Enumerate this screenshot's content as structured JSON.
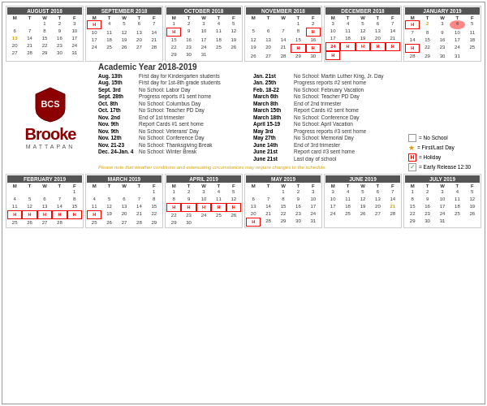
{
  "title": "Academic Year 2018-2019",
  "logo": {
    "initials": "BCS",
    "name": "Brooke",
    "location": "MATTAPAN"
  },
  "legend": {
    "noschool": "= No School",
    "firstlast": "= First/Last Day",
    "holiday": "= Holiday",
    "earlyrelease": "= Early Release 12:30"
  },
  "notice": "Please note that weather conditions and extenuating circumstances may require changes to the schedule.",
  "months_top": [
    {
      "name": "AUGUST 2018",
      "headers": [
        "M",
        "T",
        "W",
        "T",
        "F"
      ],
      "weeks": [
        [
          "",
          "",
          "1",
          "2",
          "3"
        ],
        [
          "6",
          "7",
          "8",
          "9",
          "10"
        ],
        [
          "13",
          "14",
          "15",
          "16",
          "17"
        ],
        [
          "20",
          "21",
          "22",
          "23",
          "24"
        ],
        [
          "27",
          "28",
          "29",
          "30",
          "31"
        ]
      ],
      "special": {
        "13": "firstlast",
        "15": "earlyrel"
      }
    },
    {
      "name": "SEPTEMBER 2018",
      "headers": [
        "M",
        "T",
        "W",
        "T",
        "F"
      ],
      "weeks": [
        [
          "H",
          "4",
          "5",
          "6",
          "7"
        ],
        [
          "10",
          "11",
          "12",
          "13",
          "14"
        ],
        [
          "17",
          "18",
          "19",
          "20",
          "21"
        ],
        [
          "24",
          "25",
          "26",
          "27",
          "28"
        ],
        [
          "",
          "",
          "",
          "",
          ""
        ]
      ],
      "special": {
        "H": "holiday",
        "3": "noschool"
      }
    },
    {
      "name": "OCTOBER 2018",
      "headers": [
        "M",
        "T",
        "W",
        "T",
        "F"
      ],
      "weeks": [
        [
          "1",
          "2",
          "3",
          "4",
          "5"
        ],
        [
          "H",
          "9",
          "10",
          "11",
          "12"
        ],
        [
          "15",
          "16",
          "17",
          "18",
          "19"
        ],
        [
          "22",
          "23",
          "24",
          "25",
          "26"
        ],
        [
          "29",
          "30",
          "31",
          "",
          ""
        ]
      ],
      "special": {
        "8": "holiday",
        "17": "earlyrel"
      }
    },
    {
      "name": "NOVEMBER 2018",
      "headers": [
        "M",
        "T",
        "W",
        "T",
        "F"
      ],
      "weeks": [
        [
          "",
          "",
          "",
          "1",
          "2"
        ],
        [
          "5",
          "6",
          "7",
          "8",
          "H"
        ],
        [
          "12",
          "13",
          "14",
          "15",
          "16"
        ],
        [
          "19",
          "20",
          "21",
          "H",
          "H"
        ],
        [
          "26",
          "27",
          "28",
          "29",
          "30"
        ]
      ],
      "special": {
        "9": "holiday",
        "21": "earlyrel",
        "22": "holiday",
        "23": "holiday"
      }
    },
    {
      "name": "DECEMBER 2018",
      "headers": [
        "M",
        "T",
        "W",
        "T",
        "F"
      ],
      "weeks": [
        [
          "3",
          "4",
          "5",
          "6",
          "7"
        ],
        [
          "10",
          "11",
          "12",
          "13",
          "14"
        ],
        [
          "17",
          "18",
          "19",
          "20",
          "21"
        ],
        [
          "24",
          "H",
          "H",
          "H",
          "H"
        ],
        [
          "H",
          "",
          "",
          "",
          ""
        ]
      ],
      "special": {
        "21": "earlyrel",
        "24": "holiday",
        "25": "holiday",
        "26": "holiday",
        "27": "holiday",
        "28": "holiday",
        "31": "holiday"
      }
    },
    {
      "name": "JANUARY 2019",
      "headers": [
        "M",
        "T",
        "W",
        "T",
        "F"
      ],
      "weeks": [
        [
          "H",
          "2",
          "3",
          "4",
          "5"
        ],
        [
          "7",
          "8",
          "9",
          "10",
          "11"
        ],
        [
          "14",
          "15",
          "16",
          "17",
          "18"
        ],
        [
          "H",
          "22",
          "23",
          "24",
          "25"
        ],
        [
          "28",
          "29",
          "30",
          "31",
          ""
        ]
      ],
      "special": {
        "1": "holiday",
        "21": "holiday",
        "2": "firstlast",
        "4": "highlight"
      }
    }
  ],
  "months_bottom": [
    {
      "name": "FEBRUARY 2019",
      "headers": [
        "M",
        "T",
        "W",
        "T",
        "F"
      ],
      "weeks": [
        [
          "",
          "",
          "",
          "",
          "1"
        ],
        [
          "4",
          "5",
          "6",
          "7",
          "8"
        ],
        [
          "11",
          "12",
          "13",
          "14",
          "15"
        ],
        [
          "H",
          "H",
          "H",
          "H",
          "H"
        ],
        [
          "25",
          "26",
          "27",
          "28",
          ""
        ]
      ],
      "special": {
        "18": "holiday",
        "19": "holiday",
        "20": "holiday",
        "21": "holiday",
        "22": "holiday"
      }
    },
    {
      "name": "MARCH 2019",
      "headers": [
        "M",
        "T",
        "W",
        "T",
        "F"
      ],
      "weeks": [
        [
          "",
          "",
          "",
          "",
          "1"
        ],
        [
          "4",
          "5",
          "6",
          "7",
          "8"
        ],
        [
          "11",
          "12",
          "13",
          "14",
          "15"
        ],
        [
          "H",
          "19",
          "20",
          "21",
          "22"
        ],
        [
          "25",
          "26",
          "27",
          "28",
          "29"
        ]
      ],
      "special": {
        "18": "holiday",
        "6": "earlyrel"
      }
    },
    {
      "name": "APRIL 2019",
      "headers": [
        "M",
        "T",
        "W",
        "T",
        "F"
      ],
      "weeks": [
        [
          "1",
          "2",
          "3",
          "4",
          "5"
        ],
        [
          "8",
          "9",
          "10",
          "11",
          "12"
        ],
        [
          "H",
          "H",
          "H",
          "H",
          "H"
        ],
        [
          "22",
          "23",
          "24",
          "25",
          "26"
        ],
        [
          "29",
          "30",
          "",
          "",
          ""
        ]
      ],
      "special": {
        "15": "holiday",
        "16": "holiday",
        "17": "holiday",
        "18": "holiday",
        "19": "holiday"
      }
    },
    {
      "name": "MAY 2019",
      "headers": [
        "M",
        "T",
        "W",
        "T",
        "F"
      ],
      "weeks": [
        [
          "",
          "",
          "1",
          "2",
          "3"
        ],
        [
          "6",
          "7",
          "8",
          "9",
          "10"
        ],
        [
          "13",
          "14",
          "15",
          "16",
          "17"
        ],
        [
          "20",
          "21",
          "22",
          "23",
          "24"
        ],
        [
          "H",
          "28",
          "29",
          "30",
          "31"
        ]
      ],
      "special": {
        "27": "holiday"
      }
    },
    {
      "name": "JUNE 2019",
      "headers": [
        "M",
        "T",
        "W",
        "T",
        "F"
      ],
      "weeks": [
        [
          "3",
          "4",
          "5",
          "6",
          "7"
        ],
        [
          "10",
          "11",
          "12",
          "13",
          "14"
        ],
        [
          "17",
          "18",
          "19",
          "20",
          "21"
        ],
        [
          "24",
          "25",
          "26",
          "27",
          "28"
        ],
        [
          "",
          "",
          "",
          "",
          ""
        ]
      ],
      "special": {
        "21": "firstlast"
      }
    },
    {
      "name": "JULY 2019",
      "headers": [
        "M",
        "T",
        "W",
        "T",
        "F"
      ],
      "weeks": [
        [
          "1",
          "2",
          "3",
          "4",
          "5"
        ],
        [
          "8",
          "9",
          "10",
          "11",
          "12"
        ],
        [
          "15",
          "16",
          "17",
          "18",
          "19"
        ],
        [
          "22",
          "23",
          "24",
          "25",
          "26"
        ],
        [
          "29",
          "30",
          "31",
          "",
          ""
        ]
      ],
      "special": {}
    }
  ],
  "events_left": [
    {
      "date": "Aug. 13th",
      "desc": "First day for Kindergarten students"
    },
    {
      "date": "Aug. 15th",
      "desc": "First day for 1st-8th grade students"
    },
    {
      "date": "Sept. 3rd",
      "desc": "No School: Labor Day"
    },
    {
      "date": "Sept. 28th",
      "desc": "Progress reports #1 sent home"
    },
    {
      "date": "Oct. 8th",
      "desc": "No School: Columbus Day"
    },
    {
      "date": "Oct. 17th",
      "desc": "No School: Teacher PD Day"
    },
    {
      "date": "Nov. 2nd",
      "desc": "End of 1st trimester"
    },
    {
      "date": "Nov. 9th",
      "desc": "Report Cards #1 sent home"
    },
    {
      "date": "Nov. 9th",
      "desc": "No School: Veterans' Day"
    },
    {
      "date": "Nov. 12th",
      "desc": "No School: Conference Day"
    },
    {
      "date": "Nov. 21-23",
      "desc": "No School: Thanksgiving Break"
    },
    {
      "date": "Dec. 24-Jan. 4",
      "desc": "No School: Winter Break"
    }
  ],
  "events_right": [
    {
      "date": "Jan. 21st",
      "desc": "No School: Martin Luther King, Jr. Day"
    },
    {
      "date": "Jan. 25th",
      "desc": "Progress reports #2 sent home"
    },
    {
      "date": "Feb. 18-22",
      "desc": "No School: February Vacation"
    },
    {
      "date": "March 6th",
      "desc": "No School: Teacher PD Day"
    },
    {
      "date": "March 8th",
      "desc": "End of 2nd trimester"
    },
    {
      "date": "March 15th",
      "desc": "Report Cards #2 sent home"
    },
    {
      "date": "March 18th",
      "desc": "No School: Conference Day"
    },
    {
      "date": "April 15-19",
      "desc": "No School: April Vacation"
    },
    {
      "date": "May 3rd",
      "desc": "Progress reports #3 sent home"
    },
    {
      "date": "May 27th",
      "desc": "No School: Memorial Day"
    },
    {
      "date": "June 14th",
      "desc": "End of 3rd trimester"
    },
    {
      "date": "June 21st",
      "desc": "Report card #3 sent home"
    },
    {
      "date": "June 21st",
      "desc": "Last day of school"
    }
  ]
}
